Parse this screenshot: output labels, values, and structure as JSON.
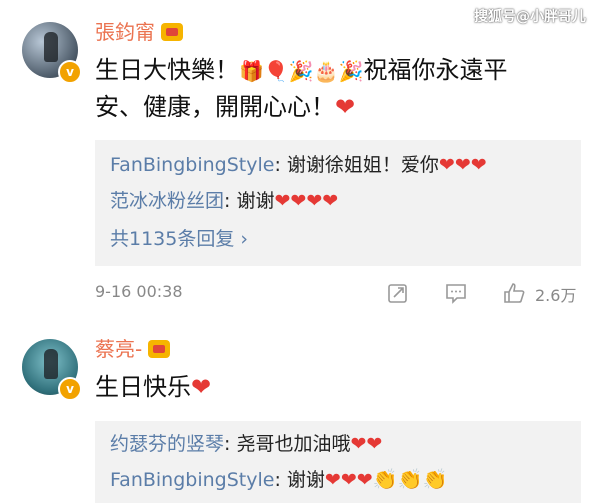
{
  "watermark": "搜狐号@小胖哥儿",
  "comments": [
    {
      "username": "張鈞甯",
      "body_line1": "生日大快樂！",
      "body_emojis": "🎁🎈🎉🎂🎉",
      "body_line1b": "祝福你永遠平",
      "body_line2": "安、健康，開開心心！",
      "heart": "❤",
      "replies": [
        {
          "who": "FanBingbingStyle",
          "text": "谢谢徐姐姐！爱你",
          "hearts": "❤❤❤"
        },
        {
          "who": "范冰冰粉丝团",
          "text": "谢谢",
          "hearts": "❤❤❤❤"
        }
      ],
      "more_replies": "共1135条回复 ›",
      "time": "9-16 00:38",
      "likes": "2.6万"
    },
    {
      "username": "蔡亮-",
      "body": "生日快乐",
      "heart": "❤",
      "replies": [
        {
          "who": "约瑟芬的竖琴",
          "text": "尧哥也加油哦",
          "hearts": "❤❤"
        },
        {
          "who": "FanBingbingStyle",
          "text": "谢谢",
          "hearts": "❤❤❤",
          "extra": "👏👏👏"
        }
      ]
    }
  ],
  "icons": {
    "share": "share-icon",
    "comment": "comment-icon",
    "like": "like-icon",
    "verified": "verified-badge-icon",
    "crown": "crown-icon"
  }
}
